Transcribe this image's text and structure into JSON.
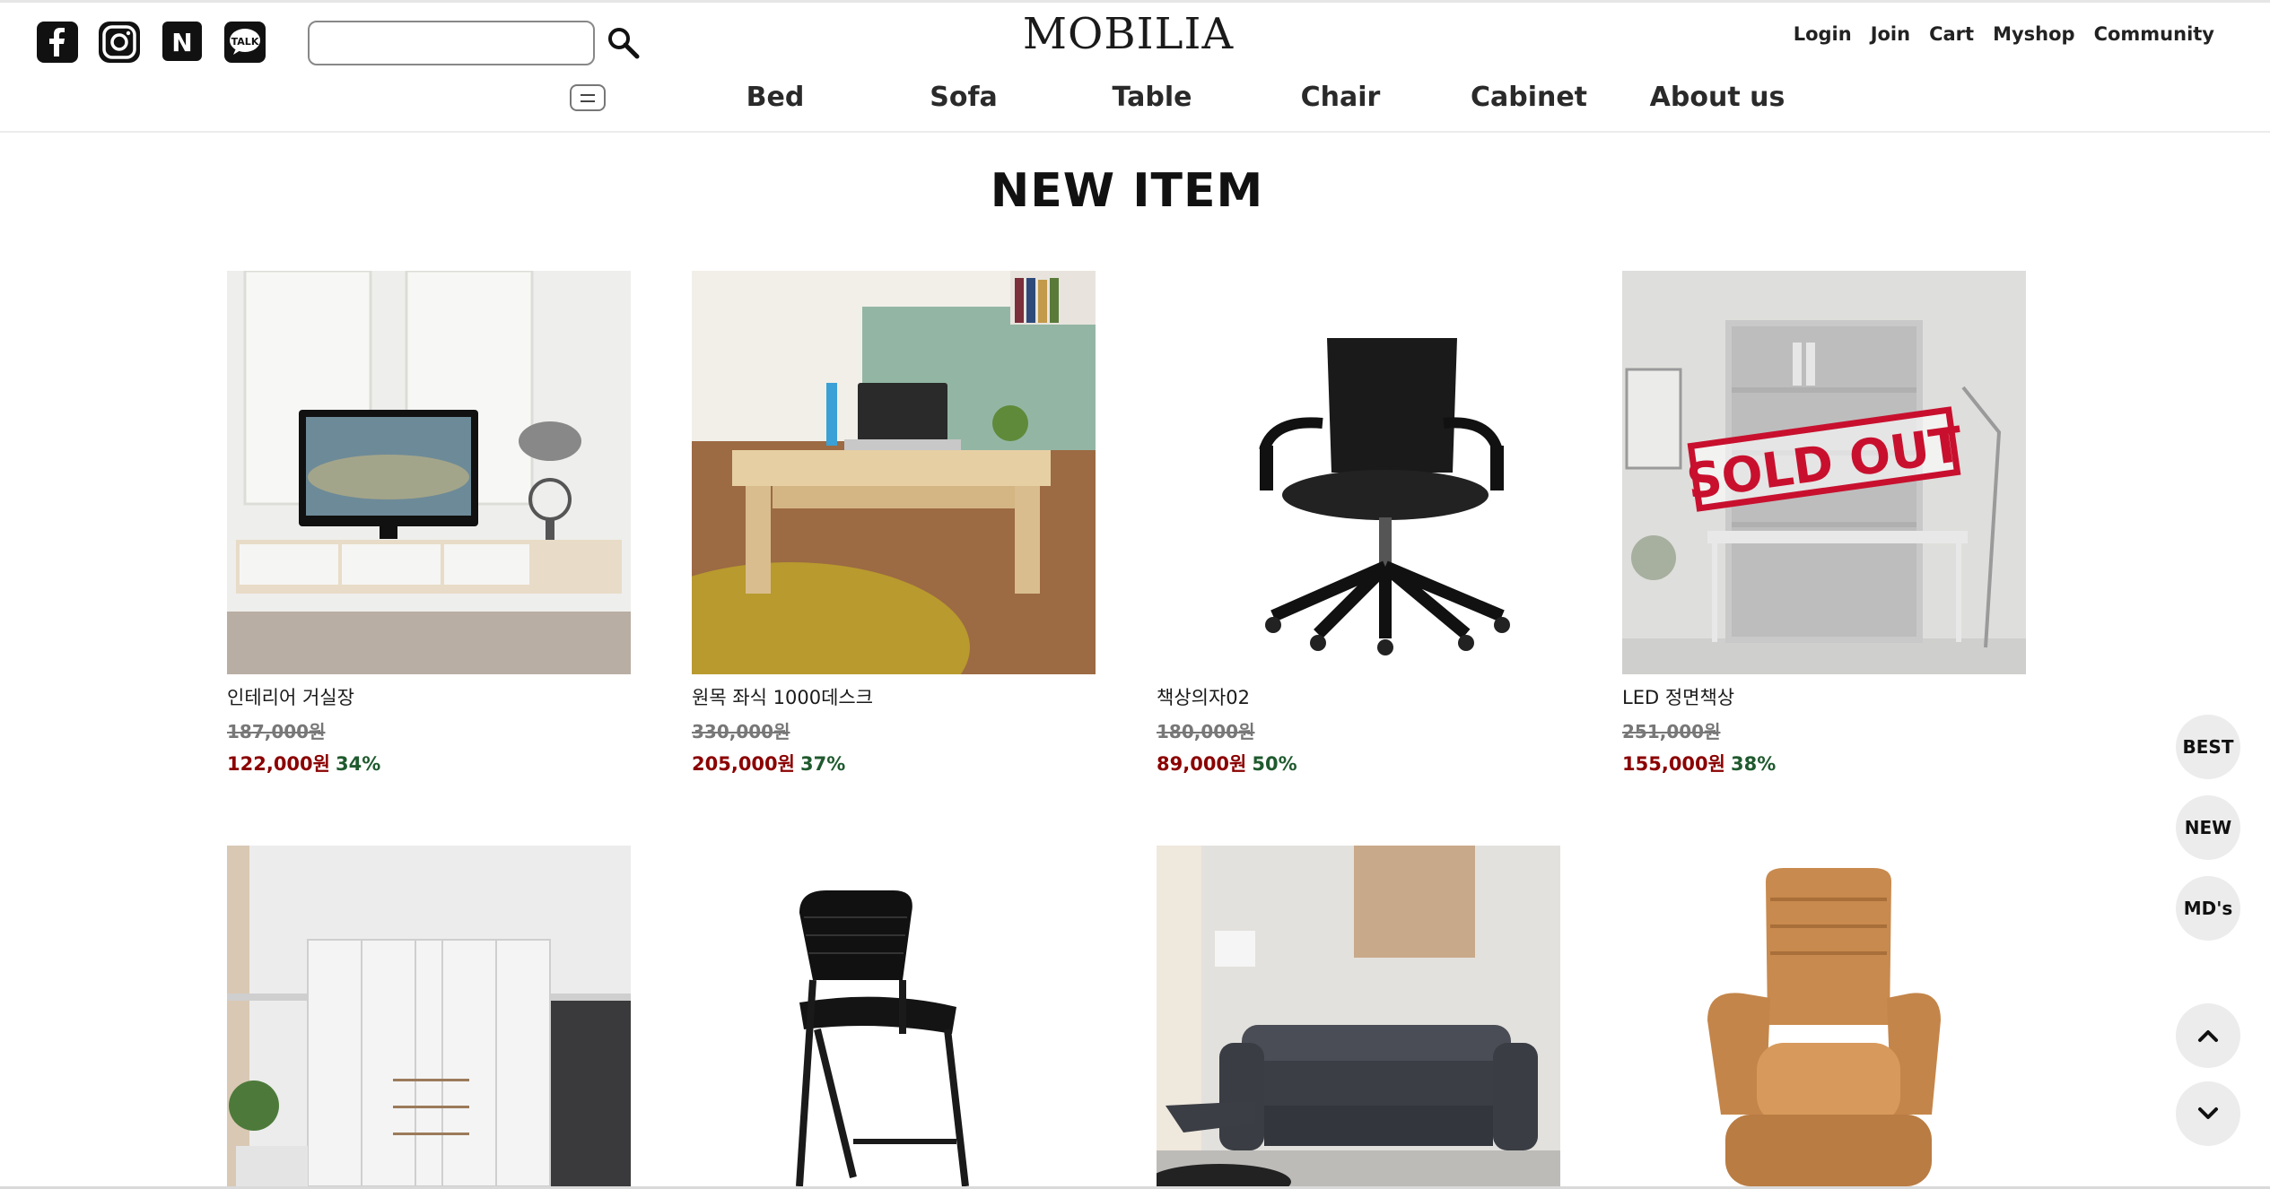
{
  "header": {
    "logo": "MOBILIA",
    "search": {
      "placeholder": "",
      "value": ""
    },
    "social_icons": [
      "facebook-icon",
      "instagram-icon",
      "naver-icon",
      "kakaotalk-icon"
    ],
    "kakao_label": "TALK",
    "naver_label": "N",
    "util_links": [
      "Login",
      "Join",
      "Cart",
      "Myshop",
      "Community"
    ],
    "categories": [
      "Bed",
      "Sofa",
      "Table",
      "Chair",
      "Cabinet",
      "About us"
    ]
  },
  "section_title": "NEW ITEM",
  "products": [
    {
      "name": "인테리어 거실장",
      "original_price": "187,000원",
      "sale_price": "122,000원",
      "discount": "34%",
      "image": "tv-cabinet-living-room"
    },
    {
      "name": "원목 좌식 1000데스크",
      "original_price": "330,000원",
      "sale_price": "205,000원",
      "discount": "37%",
      "image": "wooden-floor-desk"
    },
    {
      "name": "책상의자02",
      "original_price": "180,000원",
      "sale_price": "89,000원",
      "discount": "50%",
      "image": "black-office-chair"
    },
    {
      "name": "LED 정면책상",
      "original_price": "251,000원",
      "sale_price": "155,000원",
      "discount": "38%",
      "image": "led-desk-sold-out",
      "badge": "SOLD OUT"
    },
    {
      "name": "",
      "image": "white-wardrobe"
    },
    {
      "name": "",
      "image": "black-leather-chair"
    },
    {
      "name": "",
      "image": "gray-recliner-sofa"
    },
    {
      "name": "",
      "image": "tan-leather-recliner"
    }
  ],
  "side_buttons": {
    "best": "BEST",
    "new": "NEW",
    "mds": "MD's"
  },
  "colors": {
    "sale_price": "#8b0000",
    "discount": "#1f5a2e",
    "fab_bg": "#ececec",
    "sold_out": "#c8102e"
  }
}
